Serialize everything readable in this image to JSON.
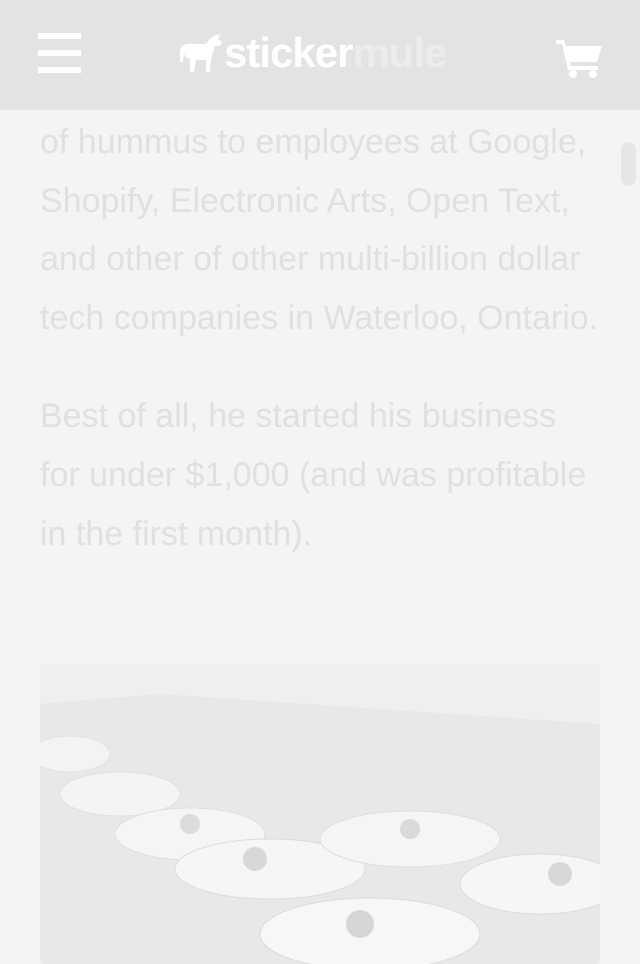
{
  "header": {
    "logo_part1": "sticker",
    "logo_part2": "mule",
    "menu_icon": "hamburger-menu-icon",
    "cart_icon": "shopping-cart-icon",
    "logo_icon": "mule-logo-icon"
  },
  "article": {
    "paragraph1": "of hummus to employees at Google, Shopify, Electronic Arts, Open Text, and other of other multi-billion dollar tech companies in Waterloo, Ontario.",
    "paragraph2": "Best of all, he started his business for under $1,000 (and was profitable in the first month)."
  },
  "colors": {
    "header_bg": "#e3e3e3",
    "page_bg": "#f4f4f4",
    "text": "#e0e0e0"
  }
}
